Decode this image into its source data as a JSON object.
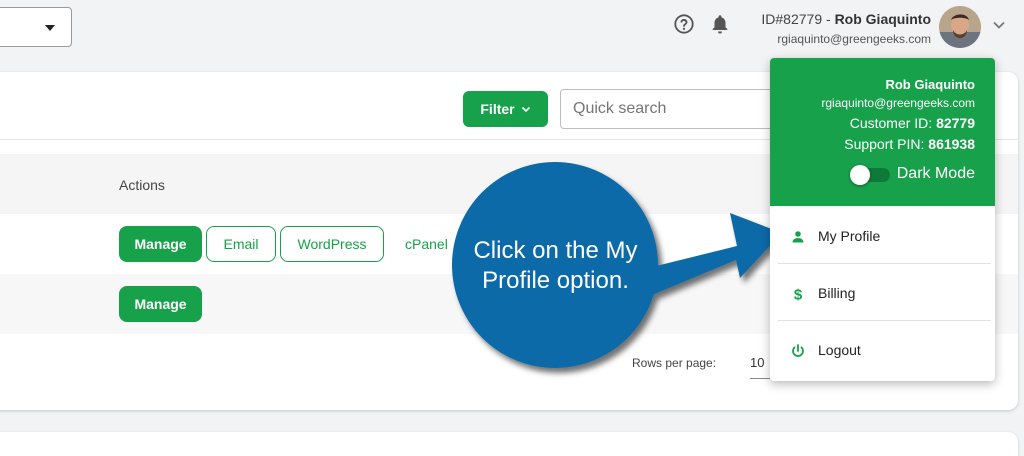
{
  "topbar": {
    "account_id": "ID#82779",
    "account_separator": " - ",
    "account_name": "Rob Giaquinto",
    "account_email": "rgiaquinto@greengeeks.com",
    "icons": [
      "help-circle-icon",
      "bell-icon",
      "chevron-down-icon"
    ]
  },
  "toolbar": {
    "filter_label": "Filter",
    "search_placeholder": "Quick search"
  },
  "table": {
    "columns": [
      "Actions"
    ],
    "rows": [
      {
        "actions": [
          "Manage",
          "Email",
          "WordPress",
          "cPanel"
        ]
      },
      {
        "actions": [
          "Manage"
        ]
      }
    ],
    "rows_per_page_label": "Rows per page:",
    "rows_per_page_value": "10"
  },
  "dropdown": {
    "name": "Rob Giaquinto",
    "email": "rgiaquinto@greengeeks.com",
    "customer_id_label": "Customer ID: ",
    "customer_id": "82779",
    "support_pin_label": "Support PIN: ",
    "support_pin": "861938",
    "dark_mode_label": "Dark Mode",
    "dark_mode_on": false,
    "items": [
      {
        "label": "My Profile",
        "icon": "person-icon"
      },
      {
        "label": "Billing",
        "icon": "dollar-icon"
      },
      {
        "label": "Logout",
        "icon": "power-icon"
      }
    ]
  },
  "callout": {
    "text": "Click on the My Profile option."
  },
  "colors": {
    "brand_green": "#18a14b",
    "callout_blue": "#0d6aa8"
  }
}
